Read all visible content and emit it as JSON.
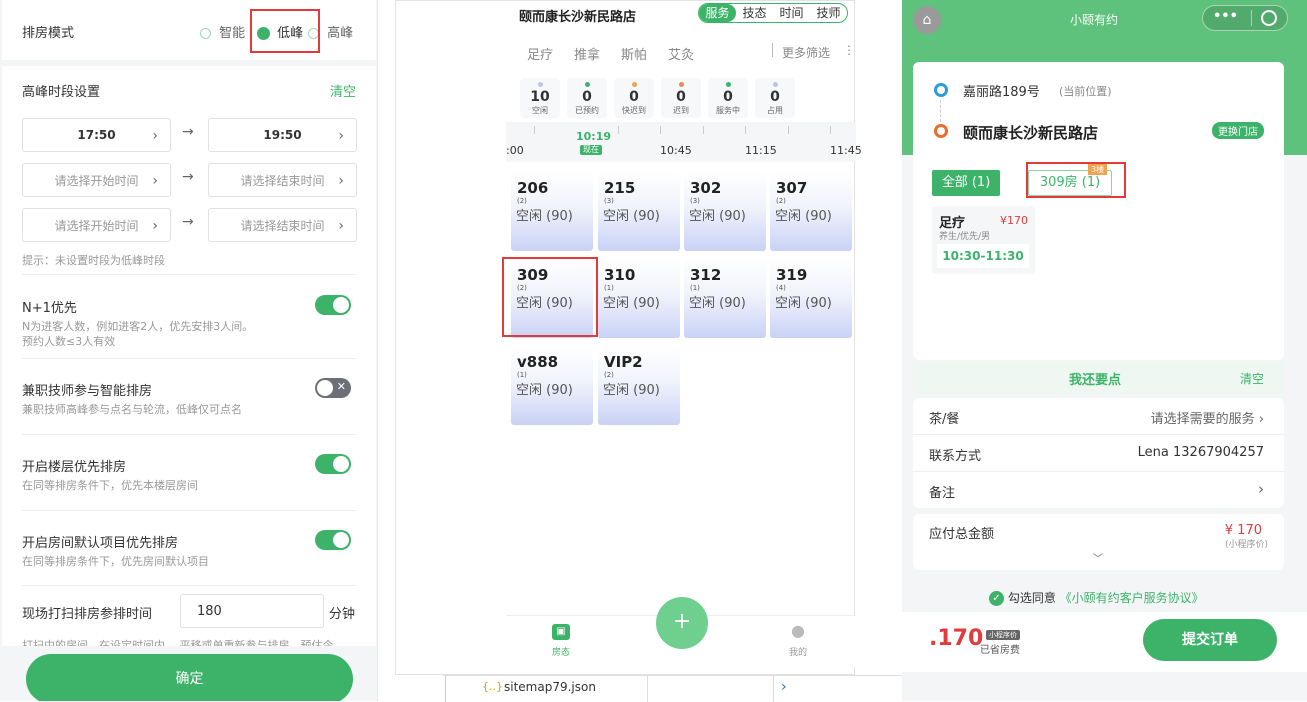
{
  "left": {
    "mode_label": "排房模式",
    "mode_options": [
      "智能",
      "低峰",
      "高峰"
    ],
    "peak_title": "高峰时段设置",
    "clear_label": "清空",
    "time_rows": [
      {
        "start": "17:50",
        "end": "19:50"
      },
      {
        "start": "请选择开始时间",
        "end": "请选择结束时间"
      },
      {
        "start": "请选择开始时间",
        "end": "请选择结束时间"
      }
    ],
    "arrow": "→",
    "hint": "提示：未设置时段为低峰时段",
    "n1_title": "N+1优先",
    "n1_desc1": "N为进客人数，例如进客2人，优先安排3人间。",
    "n1_desc2": "预约人数≤3人有效",
    "parttime_title": "兼职技师参与智能排房",
    "parttime_desc": "兼职技师高峰参与点名与轮流，低峰仅可点名",
    "floor_title": "开启楼层优先排房",
    "floor_desc": "在同等排房条件下，优先本楼层房间",
    "default_title": "开启房间默认项目优先排房",
    "default_desc": "在同等排房条件下，优先房间默认项目",
    "clean_label": "现场打扫排房参排时间",
    "clean_value": "180",
    "clean_unit": "分钟",
    "cut_text": "打扫中的房间，在设定时间内，   平移或单重新参与排房，预估今",
    "confirm": "确定"
  },
  "mid": {
    "store": "颐而康长沙新民路店",
    "seg": [
      "服务",
      "技态",
      "时间",
      "技师"
    ],
    "filters": [
      "足疗",
      "推拿",
      "斯帕",
      "艾灸"
    ],
    "more": "更多筛选",
    "stats": [
      {
        "num": "10",
        "label": "空闲",
        "color": "#b8c4ee"
      },
      {
        "num": "0",
        "label": "已预约",
        "color": "#3db36a"
      },
      {
        "num": "0",
        "label": "快迟到",
        "color": "#f0a24e"
      },
      {
        "num": "0",
        "label": "迟到",
        "color": "#f0874e"
      },
      {
        "num": "0",
        "label": "服务中",
        "color": "#3db36a"
      },
      {
        "num": "0",
        "label": "占用",
        "color": "#b8c4ee"
      }
    ],
    "timeline": {
      "now_time": "10:19",
      "now_label": "现在",
      "t0": ":00",
      "t1": "10:45",
      "t2": "11:15",
      "t3": "11:45"
    },
    "rooms": [
      {
        "no": "206",
        "cap": "(2)",
        "status": "空闲 (90)"
      },
      {
        "no": "215",
        "cap": "(3)",
        "status": "空闲 (90)"
      },
      {
        "no": "302",
        "cap": "(3)",
        "status": "空闲 (90)"
      },
      {
        "no": "307",
        "cap": "(2)",
        "status": "空闲 (90)"
      },
      {
        "no": "309",
        "cap": "(2)",
        "status": "空闲 (90)"
      },
      {
        "no": "310",
        "cap": "(1)",
        "status": "空闲 (90)"
      },
      {
        "no": "312",
        "cap": "(1)",
        "status": "空闲 (90)"
      },
      {
        "no": "319",
        "cap": "(4)",
        "status": "空闲 (90)"
      },
      {
        "no": "v888",
        "cap": "(1)",
        "status": "空闲 (90)"
      },
      {
        "no": "VIP2",
        "cap": "(2)",
        "status": "空闲 (90)"
      }
    ],
    "nav_room": "房态",
    "nav_me": "我的",
    "fab": "+"
  },
  "taskbar": {
    "file": "sitemap79.json",
    "file_icon": "{..}",
    "chev": "›"
  },
  "right": {
    "app_title": "小颐有约",
    "capsule_dots": "•••",
    "loc_addr": "嘉丽路189号",
    "loc_tag": "(当前位置)",
    "store": "颐而康长沙新民路店",
    "change_store": "更换门店",
    "tab_all": "全部 (1)",
    "tab_room": "309房 (1)",
    "floor_badge": "3楼",
    "svc_name": "足疗",
    "svc_price": "¥170",
    "svc_sub": "养生/优先/男",
    "svc_time": "10:30-11:30",
    "more_label": "我还要点",
    "clear_label": "清空",
    "tea_label": "茶/餐",
    "tea_value": "请选择需要的服务",
    "contact_label": "联系方式",
    "contact_value": "Lena 13267904257",
    "remark_label": "备注",
    "total_label": "应付总金额",
    "total_value": "¥ 170",
    "total_note": "(小程序价)",
    "agree_text": "勾选同意",
    "agreement": "《小颐有约客户服务协议》",
    "bottom_price": ".170",
    "bottom_badge": "小程序价",
    "bottom_note": "已省房费",
    "submit": "提交订单"
  },
  "colors": {
    "green": "#3db36a",
    "header_green": "#5ec27c",
    "red": "#e23b3b"
  }
}
